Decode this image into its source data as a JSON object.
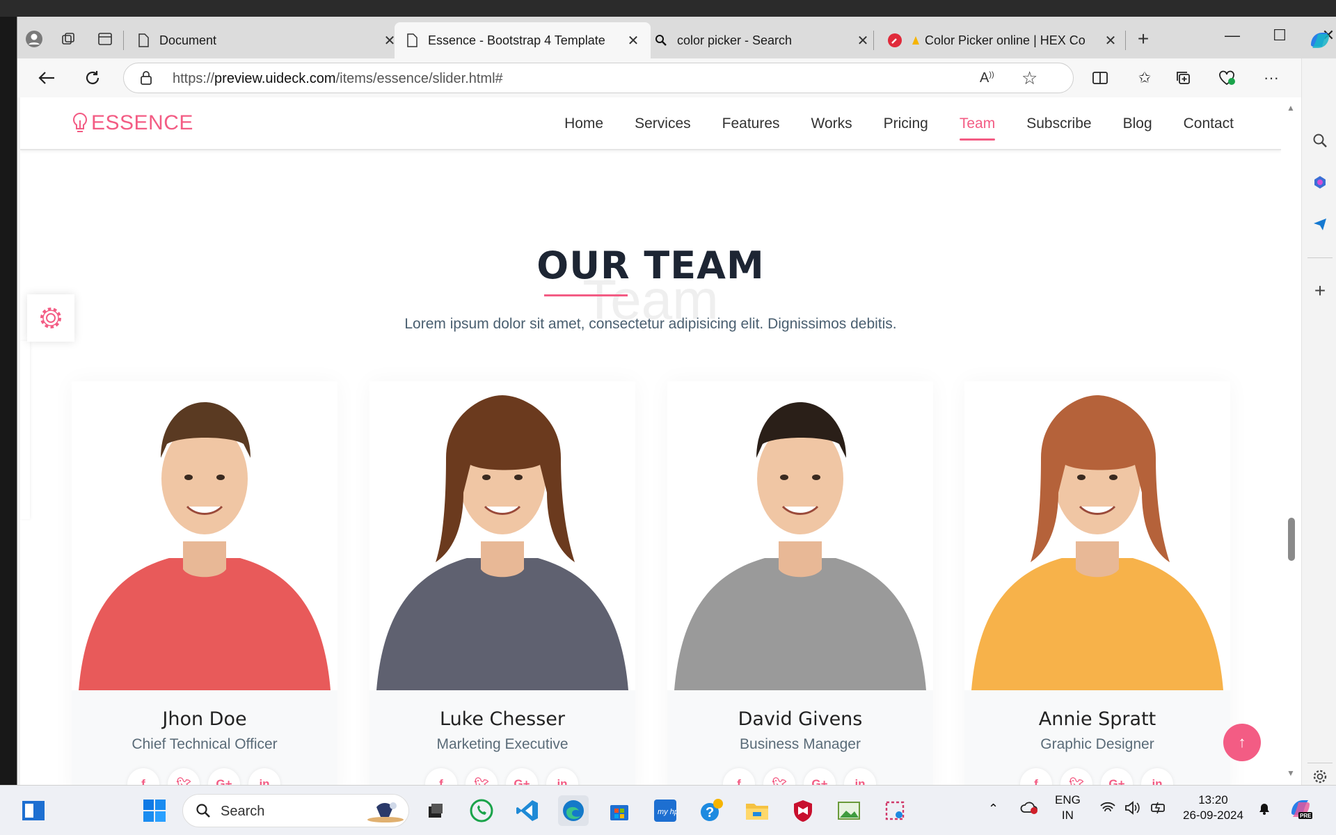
{
  "browser": {
    "tabs": [
      {
        "title": "Document",
        "active": false
      },
      {
        "title": "Essence - Bootstrap 4 Template",
        "active": true
      },
      {
        "title": "color picker - Search",
        "active": false
      },
      {
        "title": "Color Picker online | HEX Co",
        "active": false
      }
    ],
    "url_prefix": "https://",
    "url_domain": "preview.uideck.com",
    "url_path": "/items/essence/slider.html#"
  },
  "site": {
    "logo": "ESSENCE",
    "nav": [
      "Home",
      "Services",
      "Features",
      "Works",
      "Pricing",
      "Team",
      "Subscribe",
      "Blog",
      "Contact"
    ],
    "active_nav": "Team",
    "accent": "#f35c84"
  },
  "section": {
    "title": "OUR TEAM",
    "bg_word": "Team",
    "subtitle": "Lorem ipsum dolor sit amet, consectetur adipisicing elit. Dignissimos debitis."
  },
  "team": [
    {
      "name": "Jhon Doe",
      "role": "Chief Technical Officer",
      "shirt": "#e85a5a",
      "hair": "#5a3a22"
    },
    {
      "name": "Luke Chesser",
      "role": "Marketing Executive",
      "shirt": "#5f6170",
      "hair": "#6b3a1e"
    },
    {
      "name": "David Givens",
      "role": "Business Manager",
      "shirt": "#9a9a9a",
      "hair": "#2a1f18"
    },
    {
      "name": "Annie Spratt",
      "role": "Graphic Designer",
      "shirt": "#f7b24a",
      "hair": "#b5623a"
    }
  ],
  "social_icons": [
    "f",
    "t",
    "G+",
    "in"
  ],
  "taskbar": {
    "search_label": "Search",
    "lang_top": "ENG",
    "lang_bottom": "IN",
    "time": "13:20",
    "date": "26-09-2024"
  }
}
